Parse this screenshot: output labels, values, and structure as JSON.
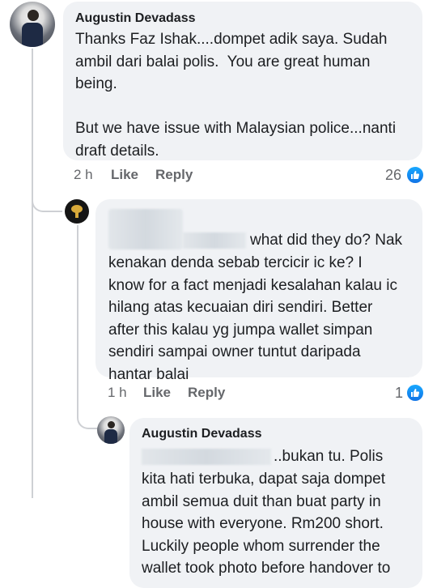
{
  "comments": [
    {
      "author": "Augustin Devadass",
      "text": "Thanks Faz Ishak....dompet adik saya. Sudah\nambil dari balai polis.  You are great human\nbeing.\n\nBut we have issue with Malaysian police...nanti\ndraft details.",
      "time": "2 h",
      "like_label": "Like",
      "reply_label": "Reply",
      "reaction_count": "26"
    },
    {
      "author": "",
      "text_first": "what did they do? Nak",
      "text_rest": "kenakan denda sebab tercicir ic ke? I\nknow for a fact menjadi kesalahan kalau ic\nhilang atas kecuaian diri sendiri. Better\nafter this kalau yg jumpa wallet simpan\nsendiri sampai owner tuntut daripada\nhantar balai",
      "time": "1 h",
      "like_label": "Like",
      "reply_label": "Reply",
      "reaction_count": "1"
    },
    {
      "author": "Augustin Devadass",
      "text_first": "..bukan tu. Polis",
      "text_rest": "kita hati terbuka, dapat saja dompet\nambil semua duit than buat party in\nhouse with everyone. Rm200 short.\nLuckily people whom surrender the\nwallet took photo before handover to"
    }
  ],
  "colors": {
    "bubble": "#f0f2f5",
    "meta": "#65676b",
    "like_blue": "#1877f2"
  },
  "icons": [
    "avatar",
    "thumbs-up-icon"
  ]
}
